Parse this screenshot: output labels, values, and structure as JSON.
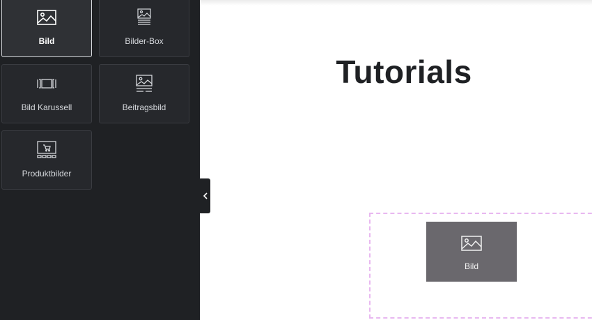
{
  "panel": {
    "widgets": [
      {
        "label": "Bild",
        "icon": "image-icon",
        "active": true
      },
      {
        "label": "Bilder-Box",
        "icon": "image-box-icon",
        "active": false
      },
      {
        "label": "Bild Karussell",
        "icon": "image-carousel-icon",
        "active": false
      },
      {
        "label": "Beitragsbild",
        "icon": "featured-image-icon",
        "active": false
      },
      {
        "label": "Produktbilder",
        "icon": "product-images-icon",
        "active": false
      }
    ],
    "collapse_icon": "chevron-left-icon"
  },
  "canvas": {
    "title": "Tutorials",
    "drag_preview": {
      "label": "Bild",
      "icon": "image-icon"
    }
  },
  "colors": {
    "panel_bg": "#1f2124",
    "drop_outline": "#e8b8f0",
    "drag_preview_bg": "#6a686d"
  }
}
